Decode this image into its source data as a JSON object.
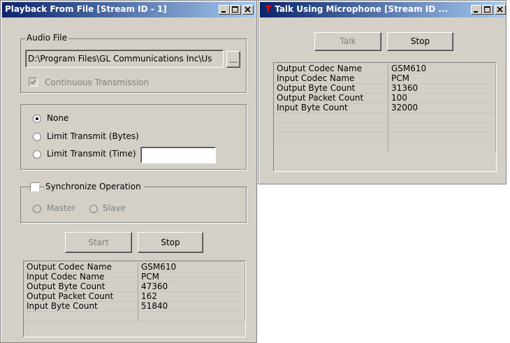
{
  "window1": {
    "title": "Playback From File [Stream ID - 1]",
    "audio_file_group_label": "Audio File",
    "file_path": "D:\\Program Files\\GL Communications Inc\\Us",
    "browse_label": "...",
    "continuous_label": "Continuous Transmission",
    "continuous_checked": true,
    "limit_options": [
      {
        "label": "None",
        "selected": true
      },
      {
        "label": "Limit Transmit (Bytes)",
        "selected": false
      },
      {
        "label": "Limit Transmit (Time)",
        "selected": false
      }
    ],
    "limit_time_value": "",
    "sync_label": "Synchronize Operation",
    "sync_checked": false,
    "master_label": "Master",
    "slave_label": "Slave",
    "start_label": "Start",
    "stop_label": "Stop",
    "stats": [
      {
        "name": "Output Codec Name",
        "value": "GSM610"
      },
      {
        "name": "Input Codec Name",
        "value": "PCM"
      },
      {
        "name": "Output Byte Count",
        "value": "47360"
      },
      {
        "name": "Output Packet Count",
        "value": "162"
      },
      {
        "name": "Input Byte Count",
        "value": "51840"
      },
      {
        "name": "",
        "value": ""
      }
    ]
  },
  "window2": {
    "title": "Talk Using Microphone [Stream ID ...",
    "talk_label": "Talk",
    "stop_label": "Stop",
    "stats": [
      {
        "name": "Output Codec Name",
        "value": "GSM610"
      },
      {
        "name": "Input Codec Name",
        "value": "PCM"
      },
      {
        "name": "Output Byte Count",
        "value": "31360"
      },
      {
        "name": "Output Packet Count",
        "value": "100"
      },
      {
        "name": "Input Byte Count",
        "value": "32000"
      },
      {
        "name": "",
        "value": ""
      },
      {
        "name": "",
        "value": ""
      },
      {
        "name": "",
        "value": ""
      },
      {
        "name": "",
        "value": ""
      }
    ]
  },
  "titlebar_buttons": {
    "minimize": "minimize-icon",
    "maximize": "maximize-icon",
    "close": "close-icon"
  },
  "colors": {
    "titlebar_start": "#0a246a",
    "titlebar_end": "#a6caf0",
    "face": "#d4d0c8",
    "app_icon": "#ff0000"
  }
}
